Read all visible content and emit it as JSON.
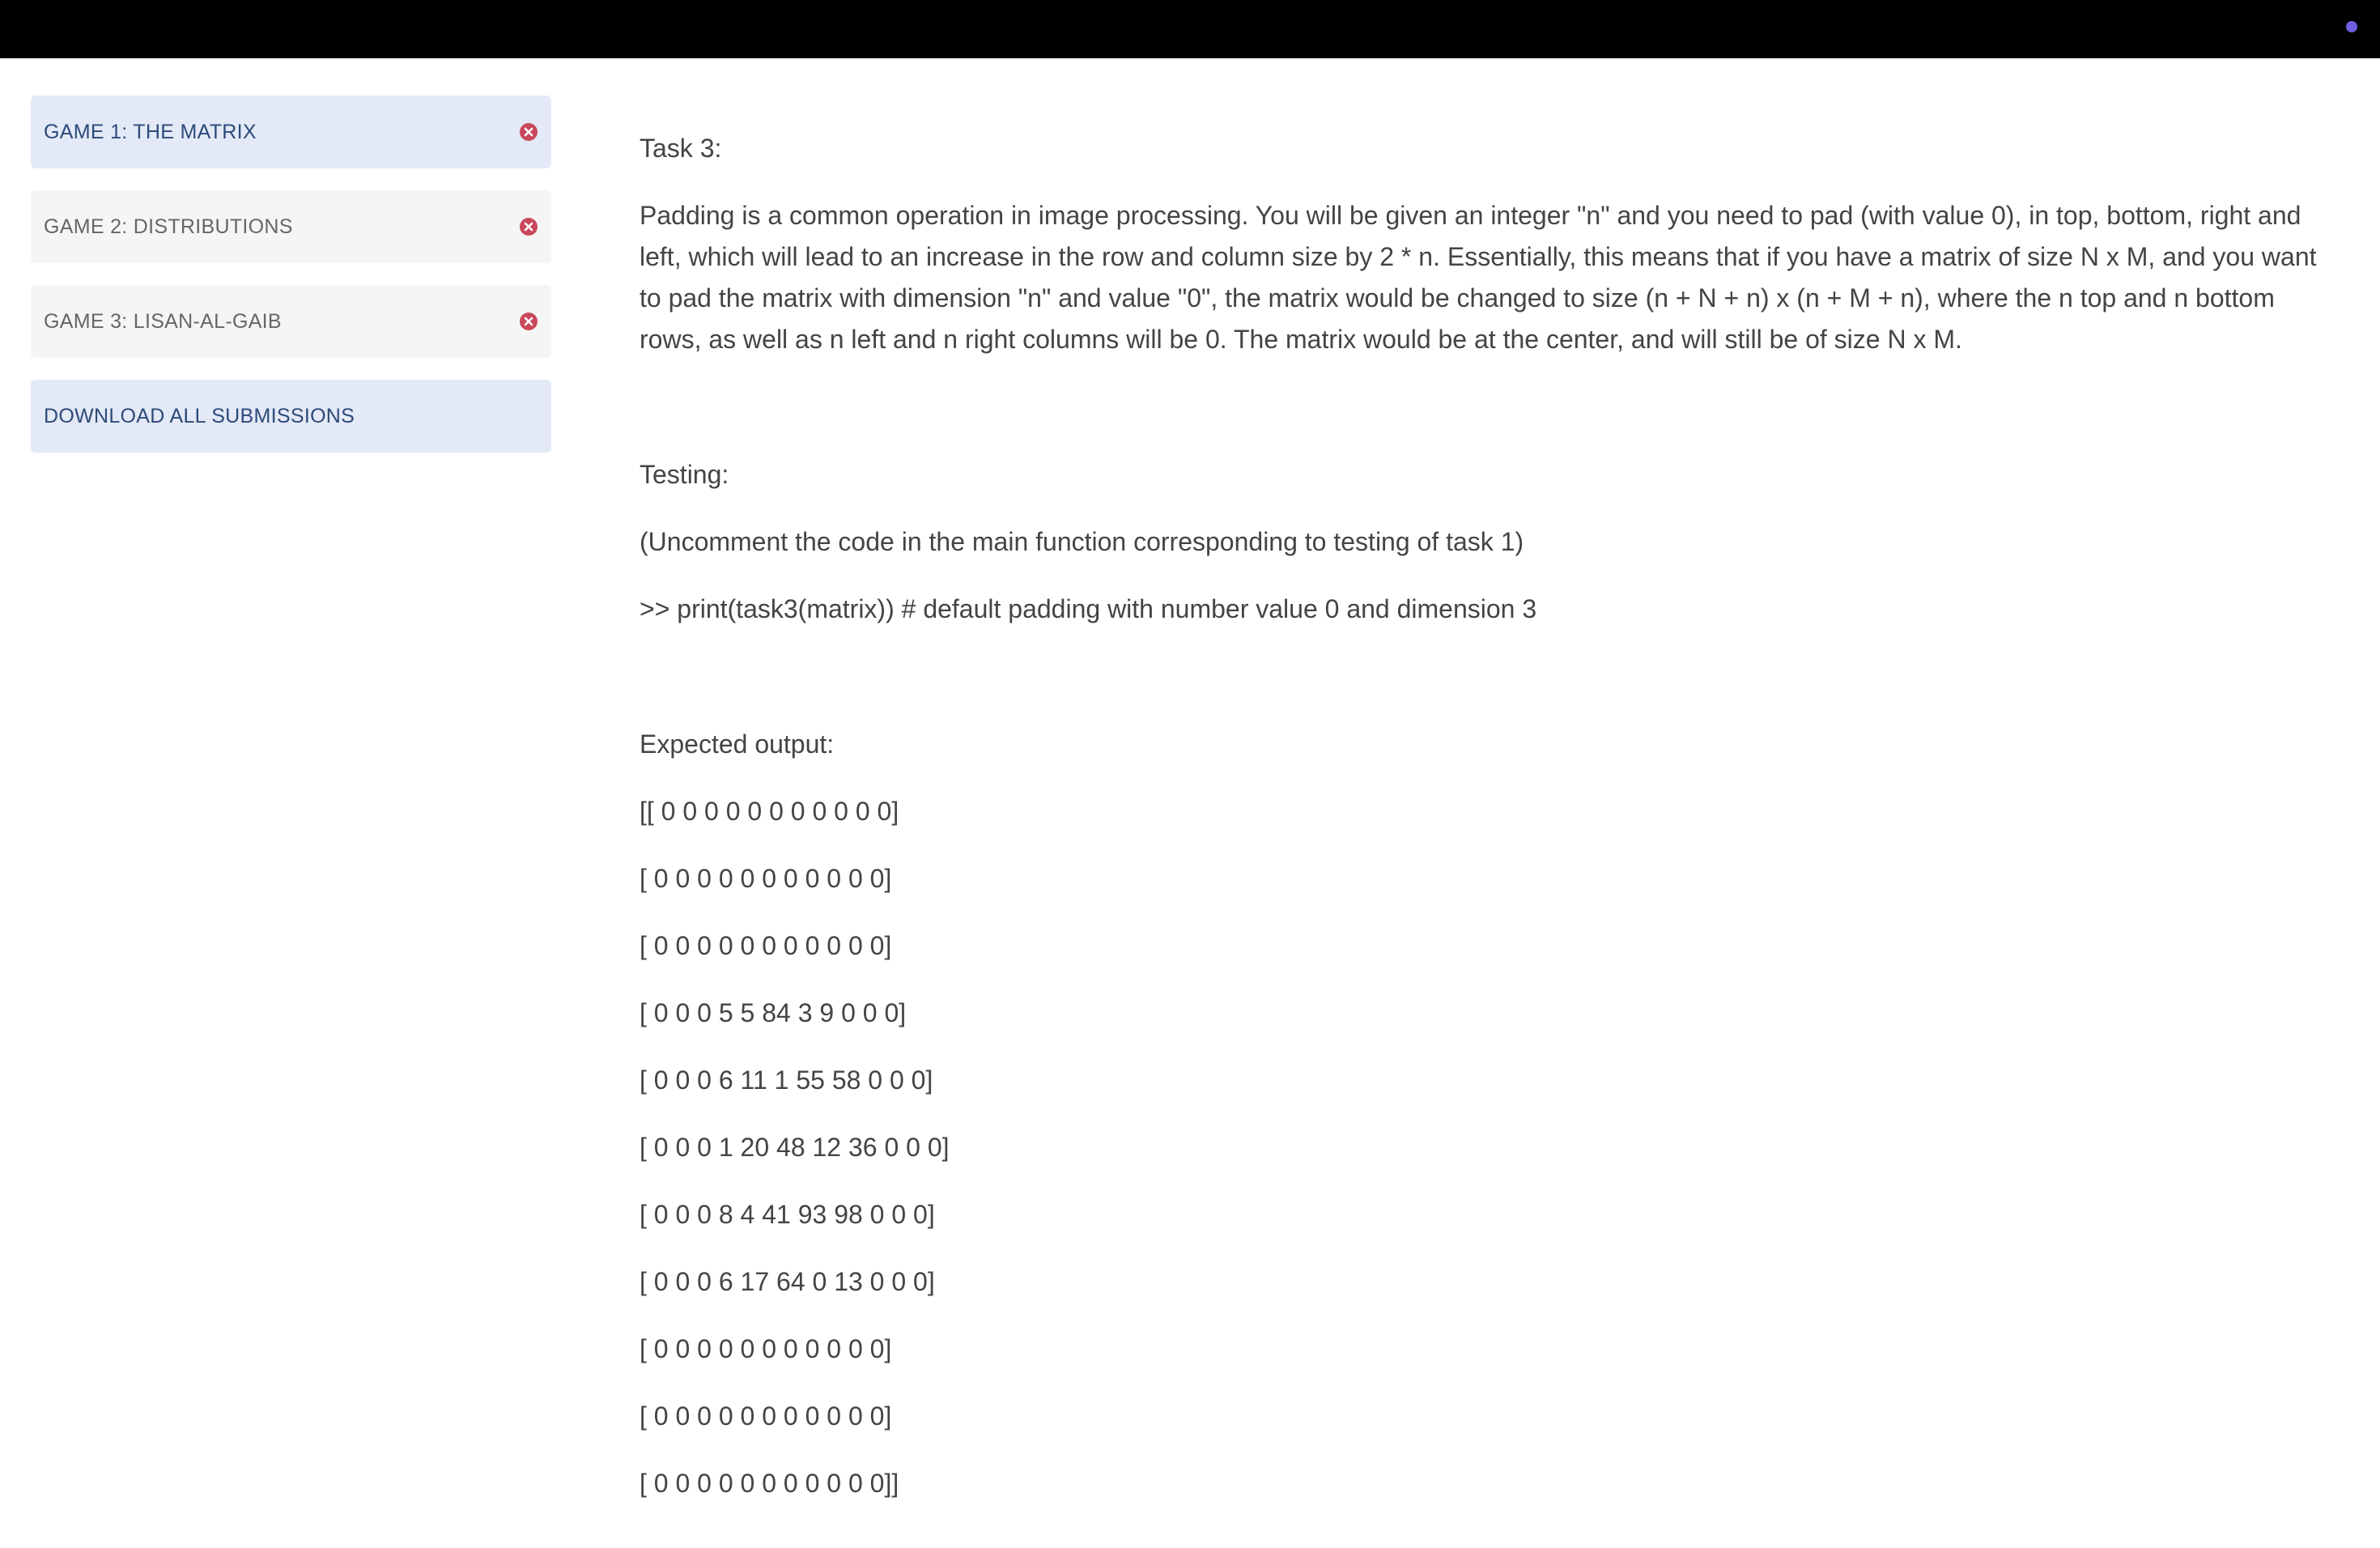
{
  "colors": {
    "topbar": "#000000",
    "status_dot": "#6d5fe0",
    "active_item_bg": "#e3e9f6",
    "inactive_item_bg": "#f5f5f5",
    "close_icon": "#c9485b"
  },
  "sidebar": {
    "items": [
      {
        "label": "GAME 1: THE MATRIX",
        "icon": "close-icon"
      },
      {
        "label": "GAME 2: DISTRIBUTIONS",
        "icon": "close-icon"
      },
      {
        "label": "GAME 3: LISAN-AL-GAIB",
        "icon": "close-icon"
      }
    ],
    "download_label": "DOWNLOAD ALL SUBMISSIONS"
  },
  "content": {
    "task_heading": "Task 3:",
    "task_description": "Padding is a common operation in image processing. You will be given an integer \"n\" and you need to pad (with value 0), in top, bottom, right and left, which will lead to an increase in the row and column size by 2 * n. Essentially, this means that if you have a matrix of size N x M, and you want to pad the matrix with dimension \"n\" and value \"0\", the matrix would be changed to size (n + N + n) x (n + M + n), where the n top and n bottom rows, as well as n left and n right columns will be 0. The matrix would be at the center, and will still be of size N x M.",
    "testing_heading": "Testing:",
    "testing_note": "(Uncomment the code in the main function corresponding to testing of task 1)",
    "testing_code": ">> print(task3(matrix)) # default padding with number value 0 and dimension 3",
    "expected_heading": "Expected output:",
    "expected_output": [
      "[[ 0 0 0 0 0 0 0 0 0 0 0]",
      "[ 0 0 0 0 0 0 0 0 0 0 0]",
      "[ 0 0 0 0 0 0 0 0 0 0 0]",
      "[ 0 0 0 5 5 84 3 9 0 0 0]",
      "[ 0 0 0 6 11 1 55 58 0 0 0]",
      "[ 0 0 0 1 20 48 12 36 0 0 0]",
      "[ 0 0 0 8 4 41 93 98 0 0 0]",
      "[ 0 0 0 6 17 64 0 13 0 0 0]",
      "[ 0 0 0 0 0 0 0 0 0 0 0]",
      "[ 0 0 0 0 0 0 0 0 0 0 0]",
      "[ 0 0 0 0 0 0 0 0 0 0 0]]"
    ]
  }
}
